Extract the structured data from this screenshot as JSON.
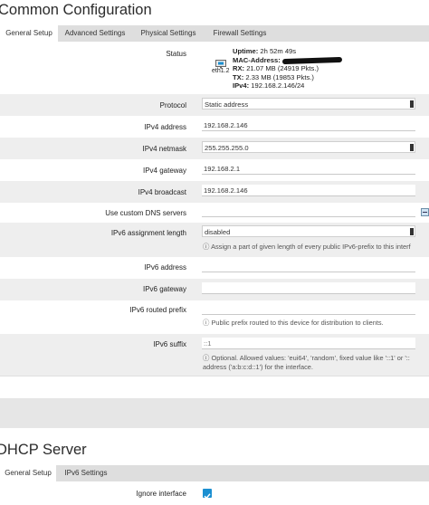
{
  "common": {
    "title": "Common Configuration",
    "tabs": [
      {
        "label": "General Setup",
        "active": true
      },
      {
        "label": "Advanced Settings",
        "active": false
      },
      {
        "label": "Physical Settings",
        "active": false
      },
      {
        "label": "Firewall Settings",
        "active": false
      }
    ],
    "status": {
      "label": "Status",
      "device": "eth1.2",
      "uptime_label": "Uptime:",
      "uptime": "2h 52m 49s",
      "mac_label": "MAC-Address:",
      "rx_label": "RX:",
      "rx": "21.07 MB (24919 Pkts.)",
      "tx_label": "TX:",
      "tx": "2.33 MB (19853 Pkts.)",
      "ipv4_label": "IPv4:",
      "ipv4": "192.168.2.146/24"
    },
    "protocol": {
      "label": "Protocol",
      "value": "Static address"
    },
    "ipv4_address": {
      "label": "IPv4 address",
      "value": "192.168.2.146"
    },
    "ipv4_netmask": {
      "label": "IPv4 netmask",
      "value": "255.255.255.0"
    },
    "ipv4_gateway": {
      "label": "IPv4 gateway",
      "value": "192.168.2.1"
    },
    "ipv4_broadcast": {
      "label": "IPv4 broadcast",
      "value": "192.168.2.146"
    },
    "custom_dns": {
      "label": "Use custom DNS servers",
      "value": ""
    },
    "ipv6_assignment": {
      "label": "IPv6 assignment length",
      "value": "disabled",
      "hint": "Assign a part of given length of every public IPv6-prefix to this interf"
    },
    "ipv6_address": {
      "label": "IPv6 address",
      "value": ""
    },
    "ipv6_gateway": {
      "label": "IPv6 gateway",
      "value": ""
    },
    "ipv6_routed_prefix": {
      "label": "IPv6 routed prefix",
      "value": "",
      "hint": "Public prefix routed to this device for distribution to clients."
    },
    "ipv6_suffix": {
      "label": "IPv6 suffix",
      "placeholder": "::1",
      "hint_line1": "Optional. Allowed values: 'eui64', 'random', fixed value like '::1' or '::",
      "hint_line2": "address ('a:b:c:d::1') for the interface."
    }
  },
  "dhcp": {
    "title": "DHCP Server",
    "tabs": [
      {
        "label": "General Setup",
        "active": true
      },
      {
        "label": "IPv6 Settings",
        "active": false
      }
    ],
    "ignore_interface": {
      "label": "Ignore interface",
      "checked": true
    }
  },
  "colors": {
    "accent": "#1b8fd1",
    "tab_bar": "#dedede",
    "row_alt": "#eeeeee"
  }
}
